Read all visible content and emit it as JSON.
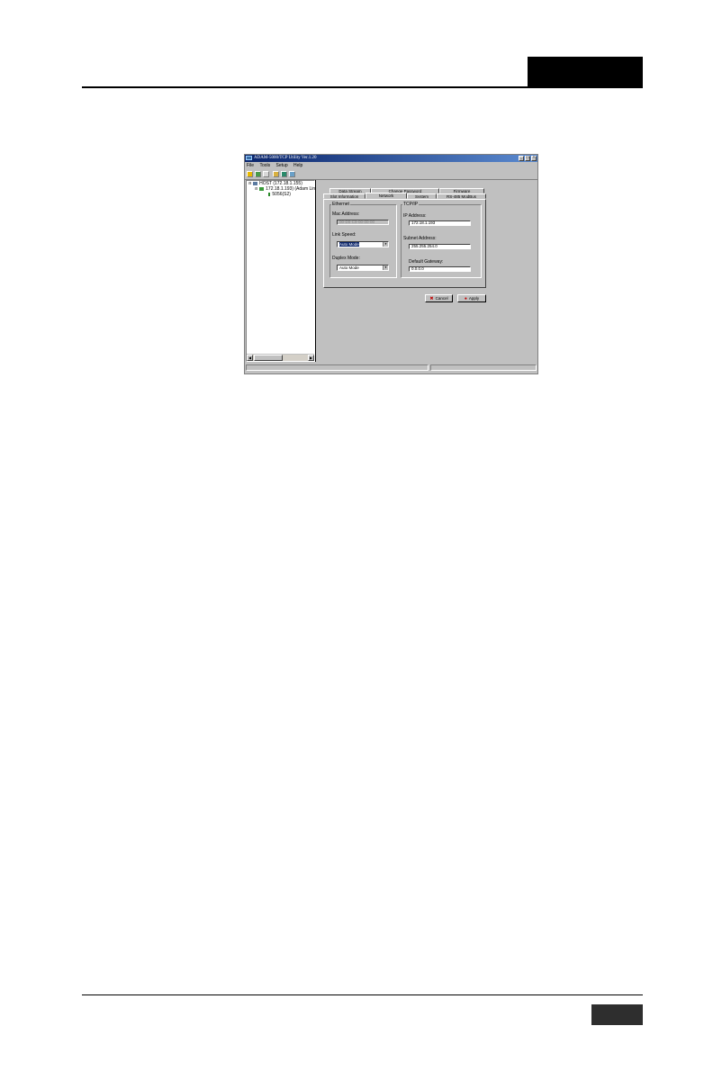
{
  "window": {
    "title": "ADAM-5000/TCP Utility Ver.1.20",
    "controls": [
      "_",
      "□",
      "×"
    ]
  },
  "menu": [
    "File",
    "Tools",
    "Setup",
    "Help"
  ],
  "toolbar": [
    "open-icon",
    "search-icon",
    "list-icon",
    "folder-icon",
    "network-icon",
    "monitor-icon"
  ],
  "tree": {
    "host": "HOST (172.18.1.155)",
    "device": "172.18.1.193) (Adam Lin",
    "module": "5056(S2)"
  },
  "tabs": {
    "row1": [
      "Data Stream",
      "Change Password",
      "Firmware"
    ],
    "row2": [
      "Slot Information",
      "Network",
      "System",
      "RS-485 ModBus"
    ],
    "active": "Network"
  },
  "ethernet": {
    "group_label": "Ethernet",
    "mac_label": "Mac Address:",
    "mac_value": "00-D0-C9-00-00-00",
    "link_speed_label": "Link Speed:",
    "link_speed_value": "Auto Mode",
    "duplex_label": "Duplex Mode:",
    "duplex_value": "Auto Mode"
  },
  "tcpip": {
    "group_label": "TCP/IP",
    "ip_label": "IP Address:",
    "ip_value": "172.18.1.193",
    "subnet_label": "Subnet Address:",
    "subnet_value": "255.255.254.0",
    "gateway_label": "Default Gateway:",
    "gateway_value": "0.0.0.0"
  },
  "buttons": {
    "cancel": "Cancel",
    "apply": "Apply"
  },
  "colors": {
    "titlebar": "#0a246a",
    "face": "#c0c0c0"
  }
}
